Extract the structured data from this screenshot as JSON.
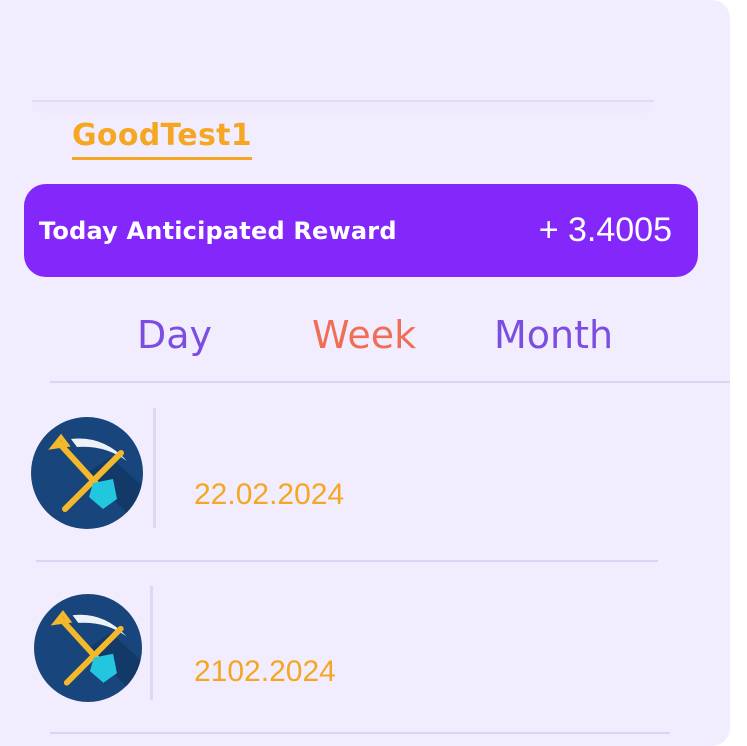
{
  "account": {
    "username": "GoodTest1"
  },
  "reward": {
    "label": "Today Anticipated Reward",
    "value": "+ 3.4005"
  },
  "tabs": [
    {
      "label": "Day",
      "active": false
    },
    {
      "label": "Week",
      "active": true
    },
    {
      "label": "Month",
      "active": false
    }
  ],
  "history": [
    {
      "icon": "pickaxe-shovel-icon",
      "date": "22.02.2024"
    },
    {
      "icon": "pickaxe-shovel-icon",
      "date": "2102.2024"
    }
  ],
  "colors": {
    "background": "#f2edfe",
    "accent_purple": "#8327fb",
    "username_orange": "#f5a623",
    "tab_inactive": "#7c4ee0",
    "tab_active": "#ef6e56",
    "avatar_bg": "#18457c"
  }
}
